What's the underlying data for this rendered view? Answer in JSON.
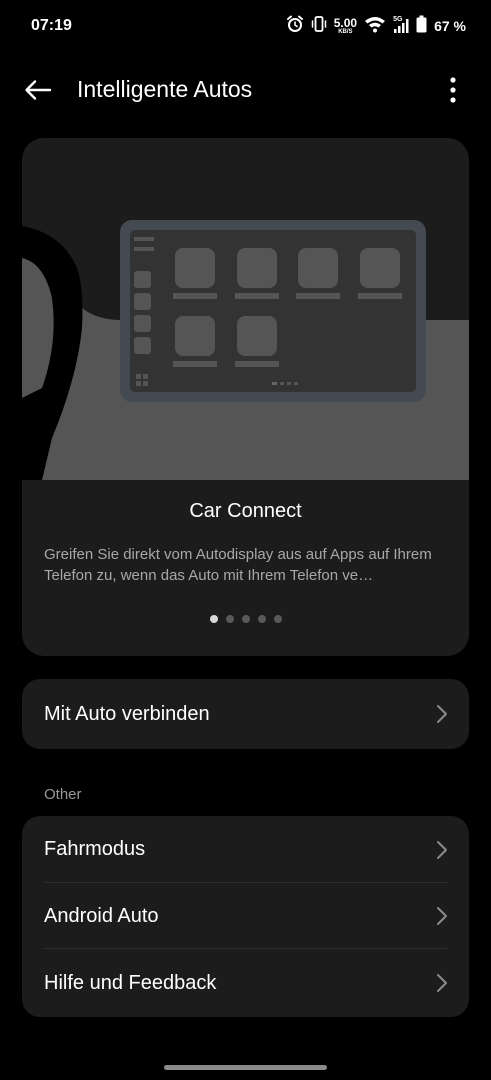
{
  "status_bar": {
    "time": "07:19",
    "net_speed_value": "5.00",
    "net_speed_unit": "KB/S",
    "network_label": "5G",
    "battery_percent": "67 %",
    "icons": [
      "alarm-icon",
      "vibrate-icon",
      "wifi-icon",
      "signal-icon",
      "battery-icon"
    ]
  },
  "app_bar": {
    "title": "Intelligente Autos",
    "back_icon": "arrow-left-icon",
    "menu_icon": "more-vertical-icon"
  },
  "hero": {
    "title": "Car Connect",
    "description": "Greifen Sie direkt vom Autodisplay aus auf Apps auf Ihrem Telefon zu, wenn das Auto mit Ihrem Telefon ve…",
    "page_count": 5,
    "active_page": 1
  },
  "connect": {
    "label": "Mit Auto verbinden"
  },
  "other": {
    "header": "Other",
    "items": [
      {
        "label": "Fahrmodus"
      },
      {
        "label": "Android Auto"
      },
      {
        "label": "Hilfe und Feedback"
      }
    ]
  },
  "colors": {
    "background": "#000000",
    "card": "#1c1c1c",
    "text_primary": "#ffffff",
    "text_secondary": "#a8a8a8",
    "chevron": "#8a8a8a"
  }
}
